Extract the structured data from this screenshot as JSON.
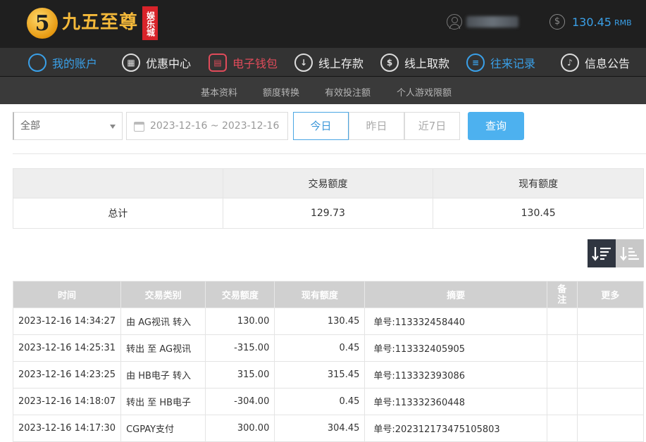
{
  "brand": {
    "badge": "5",
    "name": "九五至尊",
    "tag": "娱乐城"
  },
  "header": {
    "balance_amount": "130.45",
    "balance_currency": "RMB",
    "coin_symbol": "$"
  },
  "main_nav": [
    {
      "label": "我的账户",
      "icon": "user-circle-icon",
      "glyph": "",
      "state": "blue"
    },
    {
      "label": "优惠中心",
      "icon": "gift-icon",
      "glyph": "▦",
      "state": "normal"
    },
    {
      "label": "电子钱包",
      "icon": "wallet-icon",
      "glyph": "▤",
      "state": "red"
    },
    {
      "label": "线上存款",
      "icon": "deposit-icon",
      "glyph": "↓",
      "state": "normal"
    },
    {
      "label": "线上取款",
      "icon": "withdraw-icon",
      "glyph": "$",
      "state": "normal"
    },
    {
      "label": "往来记录",
      "icon": "record-icon",
      "glyph": "≡",
      "state": "blue"
    },
    {
      "label": "信息公告",
      "icon": "bell-icon",
      "glyph": "♪",
      "state": "normal"
    }
  ],
  "sub_nav": [
    "基本资料",
    "额度转换",
    "有效投注额",
    "个人游戏限额"
  ],
  "filters": {
    "category_selected": "全部",
    "date_range": "2023-12-16 ~ 2023-12-16",
    "day_buttons": [
      "今日",
      "昨日",
      "近7日"
    ],
    "query_label": "查询"
  },
  "summary": {
    "headers": [
      "",
      "交易额度",
      "现有额度"
    ],
    "row_label": "总计",
    "transaction_total": "129.73",
    "current_balance": "130.45"
  },
  "records": {
    "headers": [
      "时间",
      "交易类别",
      "交易额度",
      "现有额度",
      "摘要",
      "备注",
      "更多"
    ],
    "rows": [
      [
        "2023-12-16 14:34:27",
        "由 AG视讯 转入",
        "130.00",
        "130.45",
        "单号:113332458440",
        "",
        ""
      ],
      [
        "2023-12-16 14:25:31",
        "转出 至 AG视讯",
        "-315.00",
        "0.45",
        "单号:113332405905",
        "",
        ""
      ],
      [
        "2023-12-16 14:23:25",
        "由 HB电子 转入",
        "315.00",
        "315.45",
        "单号:113332393086",
        "",
        ""
      ],
      [
        "2023-12-16 14:18:07",
        "转出 至 HB电子",
        "-304.00",
        "0.45",
        "单号:113332360448",
        "",
        ""
      ],
      [
        "2023-12-16 14:17:30",
        "CGPAY支付",
        "300.00",
        "304.45",
        "单号:202312173475105803",
        "",
        ""
      ]
    ]
  },
  "colors": {
    "accent_blue": "#3aa0e8",
    "accent_red": "#e04b5a",
    "gold": "#f4b93a"
  }
}
